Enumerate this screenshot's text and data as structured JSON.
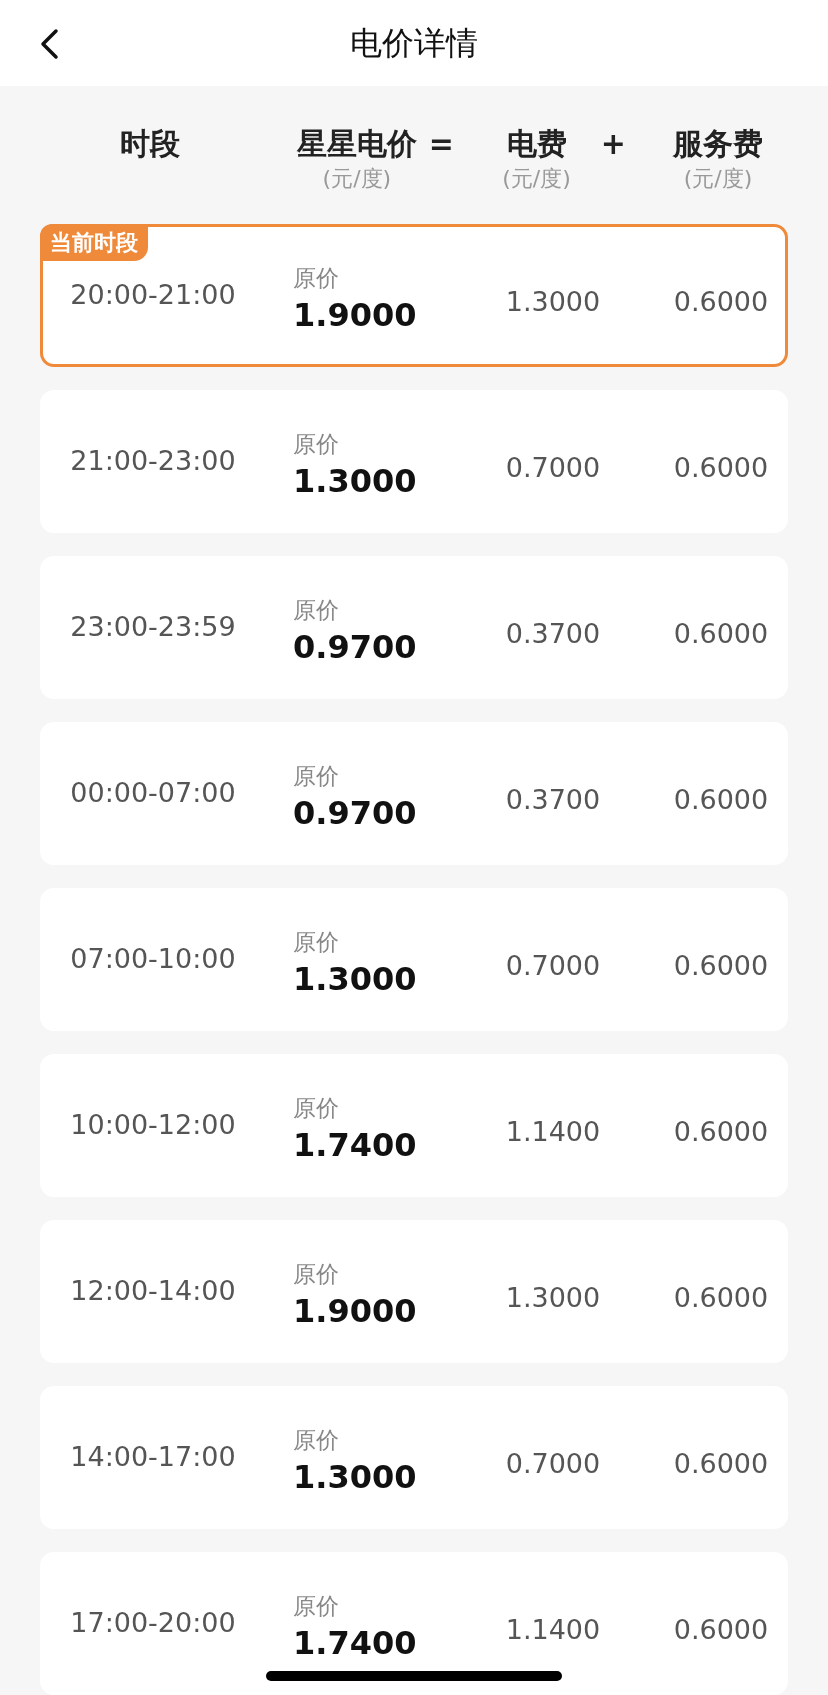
{
  "header": {
    "title": "电价详情"
  },
  "columns": [
    {
      "label": "时段"
    },
    {
      "label": "星星电价",
      "unit": "(元/度)",
      "operator": "="
    },
    {
      "label": "电费",
      "unit": "(元/度)",
      "operator": "+"
    },
    {
      "label": "服务费",
      "unit": "(元/度)"
    }
  ],
  "rows": [
    {
      "time": "20:00-21:00",
      "price_label": "原价",
      "price": "1.9000",
      "electricity_fee": "1.3000",
      "service_fee": "0.6000",
      "current": true,
      "badge": "当前时段"
    },
    {
      "time": "21:00-23:00",
      "price_label": "原价",
      "price": "1.3000",
      "electricity_fee": "0.7000",
      "service_fee": "0.6000",
      "current": false
    },
    {
      "time": "23:00-23:59",
      "price_label": "原价",
      "price": "0.9700",
      "electricity_fee": "0.3700",
      "service_fee": "0.6000",
      "current": false
    },
    {
      "time": "00:00-07:00",
      "price_label": "原价",
      "price": "0.9700",
      "electricity_fee": "0.3700",
      "service_fee": "0.6000",
      "current": false
    },
    {
      "time": "07:00-10:00",
      "price_label": "原价",
      "price": "1.3000",
      "electricity_fee": "0.7000",
      "service_fee": "0.6000",
      "current": false
    },
    {
      "time": "10:00-12:00",
      "price_label": "原价",
      "price": "1.7400",
      "electricity_fee": "1.1400",
      "service_fee": "0.6000",
      "current": false
    },
    {
      "time": "12:00-14:00",
      "price_label": "原价",
      "price": "1.9000",
      "electricity_fee": "1.3000",
      "service_fee": "0.6000",
      "current": false
    },
    {
      "time": "14:00-17:00",
      "price_label": "原价",
      "price": "1.3000",
      "electricity_fee": "0.7000",
      "service_fee": "0.6000",
      "current": false
    },
    {
      "time": "17:00-20:00",
      "price_label": "原价",
      "price": "1.7400",
      "electricity_fee": "1.1400",
      "service_fee": "0.6000",
      "current": false
    }
  ]
}
